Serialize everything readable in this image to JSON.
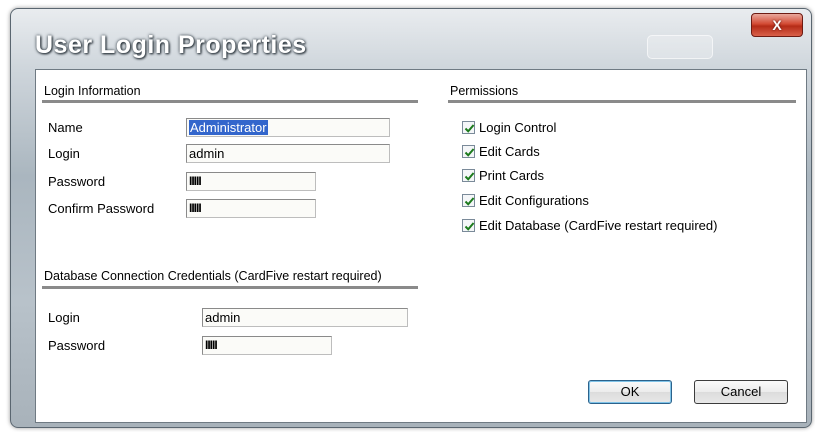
{
  "window": {
    "title": "User Login Properties",
    "close_glyph": "X"
  },
  "login_info": {
    "title": "Login Information",
    "name_label": "Name",
    "name_value": "Administrator",
    "login_label": "Login",
    "login_value": "admin",
    "password_label": "Password",
    "password_value": "IIIII",
    "confirm_label": "Confirm Password",
    "confirm_value": "IIIII"
  },
  "db_credentials": {
    "title": "Database Connection Credentials (CardFive restart required)",
    "login_label": "Login",
    "login_value": "admin",
    "password_label": "Password",
    "password_value": "IIIII"
  },
  "permissions": {
    "title": "Permissions",
    "items": [
      {
        "label": "Login Control",
        "checked": true
      },
      {
        "label": "Edit Cards",
        "checked": true
      },
      {
        "label": "Print Cards",
        "checked": true
      },
      {
        "label": "Edit Configurations",
        "checked": true
      },
      {
        "label": "Edit Database (CardFive restart required)",
        "checked": true
      }
    ]
  },
  "buttons": {
    "ok": "OK",
    "cancel": "Cancel"
  },
  "colors": {
    "selection": "#3366cc",
    "check": "#1c7a1c",
    "close_red": "#c8402a"
  }
}
